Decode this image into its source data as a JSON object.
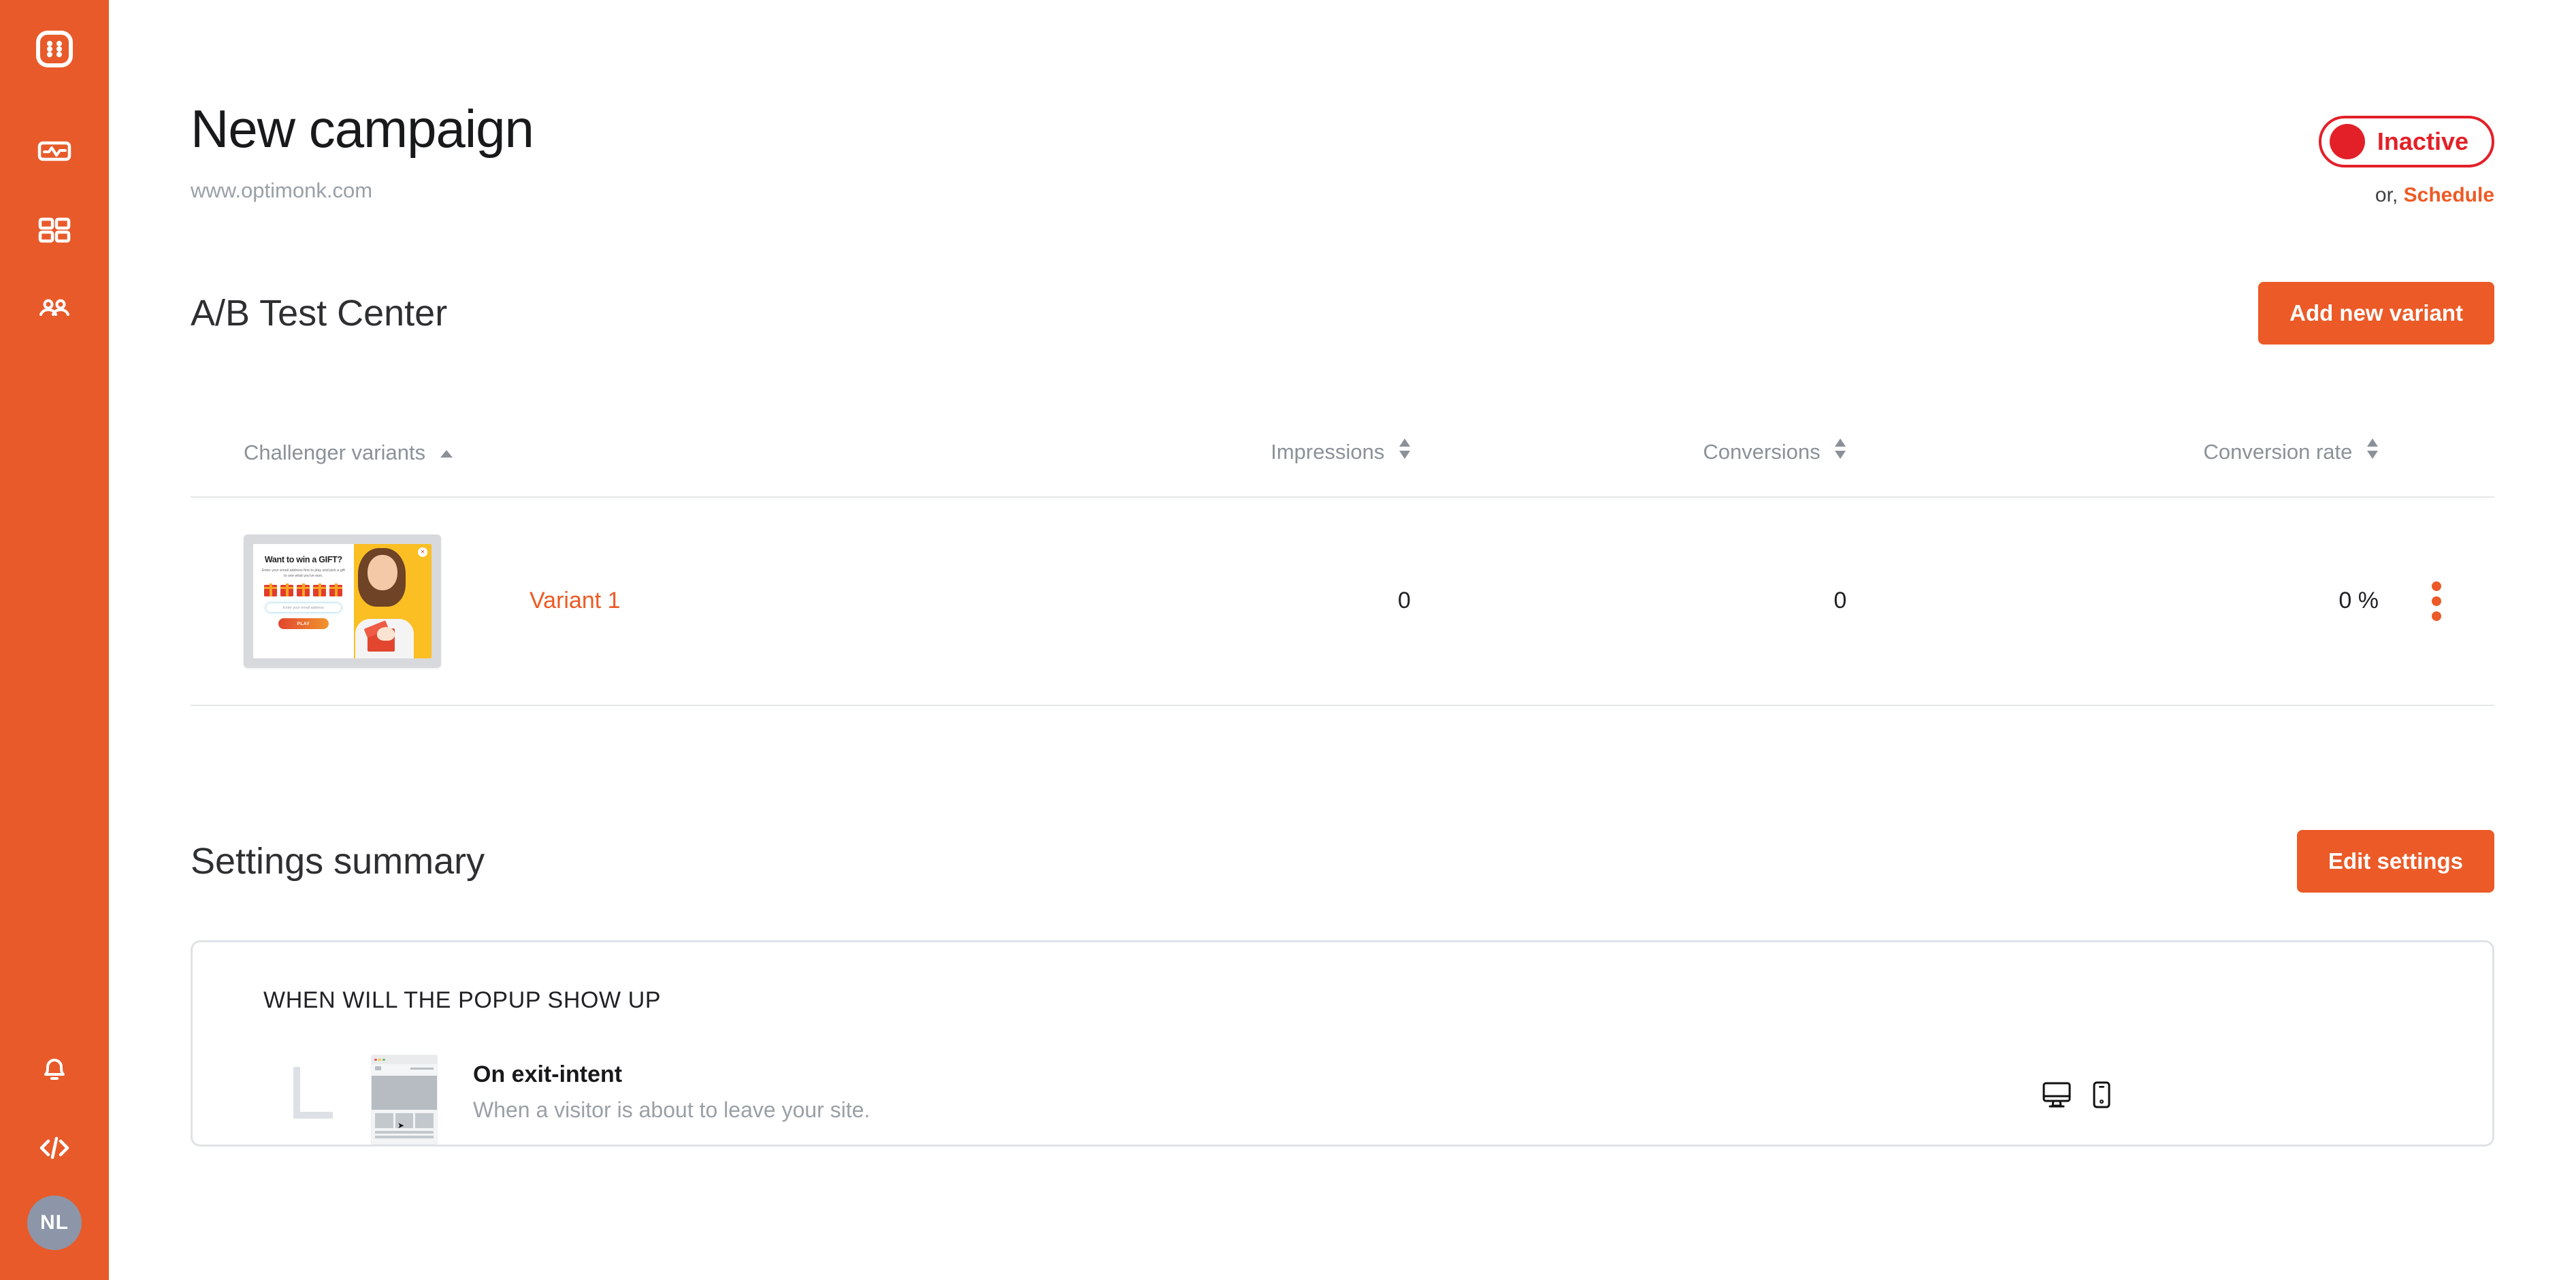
{
  "sidebar": {
    "brand_icon": "optimonk-logo-icon",
    "items": [
      {
        "icon": "analytics-pulse-icon",
        "name": "analytics"
      },
      {
        "icon": "grid-campaigns-icon",
        "name": "campaigns"
      },
      {
        "icon": "audience-people-icon",
        "name": "audience"
      }
    ],
    "bottom_items": [
      {
        "icon": "bell-notification-icon",
        "name": "notifications"
      },
      {
        "icon": "code-embed-icon",
        "name": "embed-code"
      }
    ],
    "avatar_initials": "NL"
  },
  "header": {
    "title": "New campaign",
    "url": "www.optimonk.com",
    "status_label": "Inactive",
    "status_color": "#E32028",
    "or_text": "or,",
    "schedule_label": "Schedule"
  },
  "ab_test": {
    "title": "A/B Test Center",
    "add_variant_label": "Add new variant",
    "columns": [
      {
        "label": "Challenger variants",
        "sort": "asc"
      },
      {
        "label": "Impressions",
        "sort": "both"
      },
      {
        "label": "Conversions",
        "sort": "both"
      },
      {
        "label": "Conversion rate",
        "sort": "both"
      }
    ],
    "rows": [
      {
        "name": "Variant 1",
        "impressions": "0",
        "conversions": "0",
        "conversion_rate": "0 %",
        "thumbnail": {
          "headline": "Want to win a GIFT?",
          "subtext": "Enter your email address first to play and pick a gift to see what you've won.",
          "input_placeholder": "Enter your email address",
          "button_label": "PLAY"
        }
      }
    ]
  },
  "settings": {
    "title": "Settings summary",
    "edit_label": "Edit settings",
    "card": {
      "section_title": "WHEN WILL THE POPUP SHOW UP",
      "rule_title": "On exit-intent",
      "rule_desc": "When a visitor is about to leave your site.",
      "devices": [
        "desktop-icon",
        "mobile-icon"
      ]
    }
  },
  "colors": {
    "brand_orange": "#E85A2A",
    "button_orange": "#EB5A27",
    "link_orange": "#EE5A24",
    "status_red": "#E32028",
    "muted_gray": "#9aa0a6"
  }
}
